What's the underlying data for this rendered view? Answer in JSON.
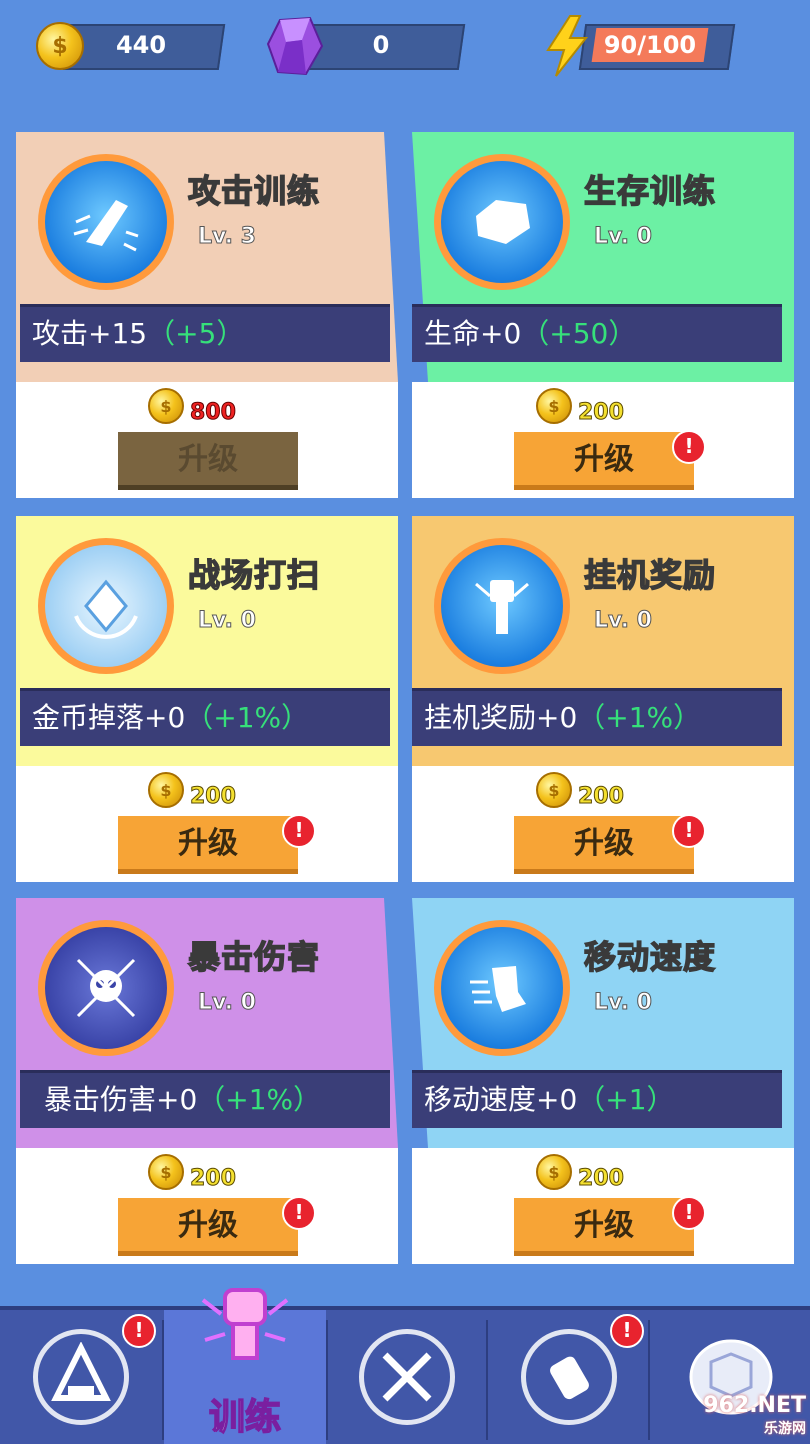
{
  "resources": {
    "gold": {
      "value": "440",
      "icon": "gold-coin-icon"
    },
    "gem": {
      "value": "0",
      "icon": "purple-gem-icon"
    },
    "energy": {
      "value": "90/100",
      "icon": "lightning-icon"
    }
  },
  "cards": [
    {
      "title": "攻击训练",
      "level": "Lv. 3",
      "stat_main": "攻击+15",
      "stat_plus": "（+5）",
      "cost": "800",
      "button": "升级",
      "bg_color": "#f2cfb6",
      "icon": "sword-fist-icon",
      "affordable": false,
      "alert": ""
    },
    {
      "title": "生存训练",
      "level": "Lv. 0",
      "stat_main": "生命+0",
      "stat_plus": "（+50）",
      "cost": "200",
      "button": "升级",
      "bg_color": "#6cf0a4",
      "icon": "armor-icon",
      "affordable": true,
      "alert": "!"
    },
    {
      "title": "战场打扫",
      "level": "Lv. 0",
      "stat_main": "金币掉落+0",
      "stat_plus": "（+1%）",
      "cost": "200",
      "button": "升级",
      "bg_color": "#fbfa9c",
      "icon": "diamond-magnet-icon",
      "affordable": true,
      "alert": "!"
    },
    {
      "title": "挂机奖励",
      "level": "Lv. 0",
      "stat_main": "挂机奖励+0",
      "stat_plus": "（+1%）",
      "cost": "200",
      "button": "升级",
      "bg_color": "#f7c870",
      "icon": "raised-fist-icon",
      "affordable": true,
      "alert": "!"
    },
    {
      "title": "暴击伤害",
      "level": "Lv. 0",
      "stat_main": "暴击伤害+0",
      "stat_plus": "（+1%）",
      "cost": "200",
      "button": "升级",
      "bg_color": "#cf90e8",
      "icon": "skull-crosshair-icon",
      "affordable": true,
      "alert": "!"
    },
    {
      "title": "移动速度",
      "level": "Lv. 0",
      "stat_main": "移动速度+0",
      "stat_plus": "（+1）",
      "cost": "200",
      "button": "升级",
      "bg_color": "#8fd4f4",
      "icon": "running-boot-icon",
      "affordable": true,
      "alert": "!"
    }
  ],
  "nav": {
    "items": [
      {
        "icon": "hexagon-base-icon",
        "alert": "!"
      },
      {
        "icon": "power-fist-icon",
        "label": "训练",
        "active": true
      },
      {
        "icon": "crossed-guns-icon"
      },
      {
        "icon": "grenade-icon",
        "alert": "!"
      },
      {
        "icon": "turtle-shell-icon"
      }
    ]
  },
  "watermark": {
    "text": "962.NET",
    "sub": "乐游网"
  }
}
